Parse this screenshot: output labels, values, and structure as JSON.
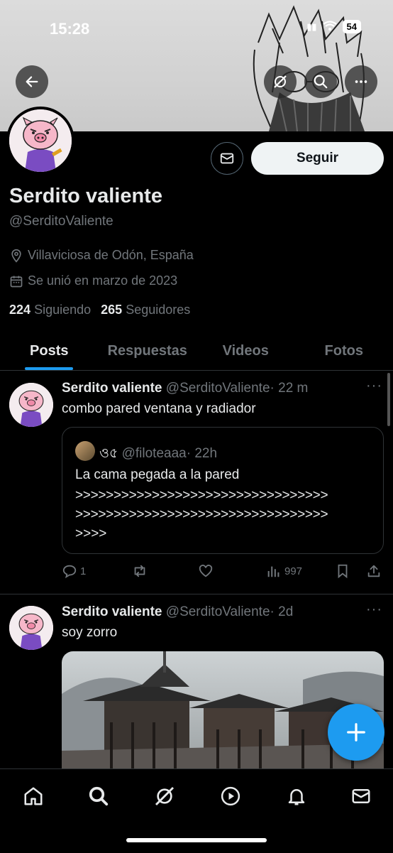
{
  "status_bar": {
    "time": "15:28",
    "battery": "54"
  },
  "header": {
    "back_icon": "arrow-left-icon",
    "grok_icon": "grok-icon",
    "search_icon": "search-icon",
    "more_icon": "more-icon"
  },
  "profile": {
    "name": "Serdito valiente",
    "handle": "@SerditoValiente",
    "location": "Villaviciosa de Odón, España",
    "joined": "Se unió en marzo de 2023",
    "following_count": "224",
    "following_label": "Siguiendo",
    "followers_count": "265",
    "followers_label": "Seguidores",
    "follow_button": "Seguir"
  },
  "tabs": [
    {
      "label": "Posts",
      "active": true
    },
    {
      "label": "Respuestas",
      "active": false
    },
    {
      "label": "Videos",
      "active": false
    },
    {
      "label": "Fotos",
      "active": false
    }
  ],
  "posts": [
    {
      "author": "Serdito valiente",
      "handle": "@SerditoValiente",
      "time": "· 22 m",
      "text": "combo pared ventana y radiador",
      "quote": {
        "author": "ও৫",
        "handle": "@filoteaaa",
        "time": "· 22h",
        "text": "La cama pegada a la pared",
        "line1": ">>>>>>>>>>>>>>>>>>>>>>>>>>>>>>>>>",
        "line2": ">>>>>>>>>>>>>>>>>>>>>>>>>>>>>>>>>",
        "line3": ">>>>"
      },
      "replies": "1",
      "views": "997"
    },
    {
      "author": "Serdito valiente",
      "handle": "@SerditoValiente",
      "time": "· 2d",
      "text": "soy zorro"
    }
  ],
  "colors": {
    "accent": "#1d9bf0",
    "background": "#000000",
    "muted": "#71767b",
    "border": "#2f3336"
  }
}
